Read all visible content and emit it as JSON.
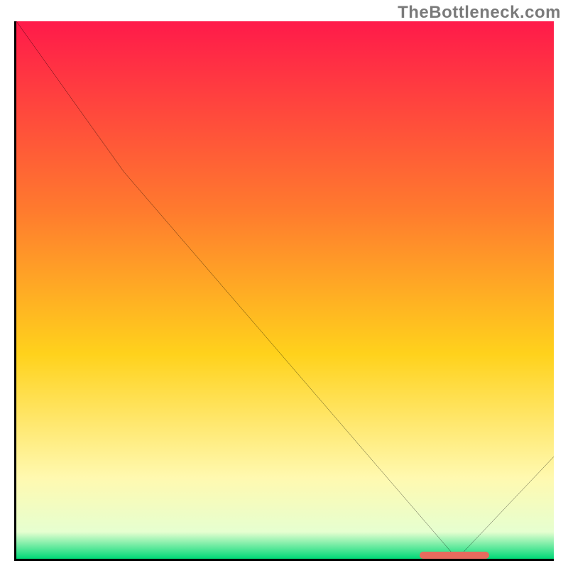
{
  "watermark": "TheBottleneck.com",
  "colors": {
    "axis": "#000000",
    "curve": "#000000",
    "marker": "#e86a5e",
    "gradient_top": "#ff1a4a",
    "gradient_upper_mid": "#ff7a2e",
    "gradient_mid": "#ffd21c",
    "gradient_lower_mid": "#fff9b0",
    "gradient_lower": "#e6ffd0",
    "gradient_bottom": "#00d977"
  },
  "chart_data": {
    "type": "line",
    "title": "",
    "xlabel": "",
    "ylabel": "",
    "xlim": [
      0,
      100
    ],
    "ylim": [
      0,
      100
    ],
    "x": [
      0,
      20,
      82,
      100
    ],
    "values": [
      100,
      72,
      0,
      19
    ],
    "marker_segment": {
      "x_start": 75,
      "x_end": 88,
      "y": 0
    },
    "annotations": []
  }
}
